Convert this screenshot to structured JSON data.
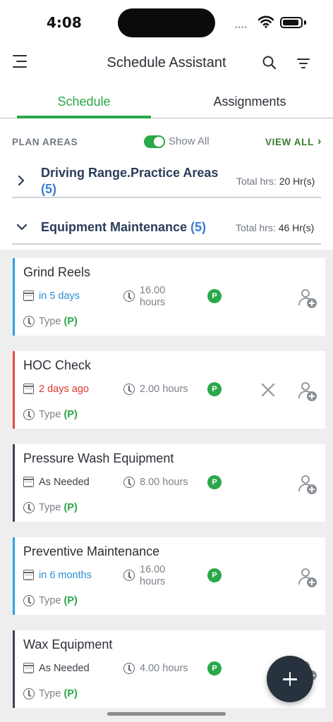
{
  "status_bar": {
    "time": "4:08",
    "battery_level": 0.9
  },
  "header": {
    "title": "Schedule Assistant"
  },
  "tabs": [
    {
      "label": "Schedule",
      "active": true
    },
    {
      "label": "Assignments",
      "active": false
    }
  ],
  "plan_areas": {
    "label": "PLAN AREAS",
    "show_all_label": "Show All",
    "show_all_on": true,
    "view_all_label": "VIEW ALL"
  },
  "sections": [
    {
      "title": "Driving Range.Practice Areas",
      "count": "(5)",
      "total_label": "Total hrs:",
      "total_value": "20 Hr(s)",
      "expanded": false
    },
    {
      "title": "Equipment Maintenance",
      "count": "(5)",
      "total_label": "Total hrs:",
      "total_value": "46 Hr(s)",
      "expanded": true
    }
  ],
  "tasks": [
    {
      "name": "Grind Reels",
      "due": "in 5 days",
      "hours_value": "16.00",
      "hours_unit": "hours",
      "badge": "P",
      "type_label": "Type",
      "type_value": "(P)",
      "status": "upcoming",
      "accent": "#2aa0e6",
      "due_color": "#2a8fd6"
    },
    {
      "name": "HOC Check",
      "due": "2 days ago",
      "hours_value": "2.00 hours",
      "hours_unit": "",
      "badge": "P",
      "type_label": "Type",
      "type_value": "(P)",
      "status": "overdue",
      "accent": "#e04a3f",
      "due_color": "#d9382c"
    },
    {
      "name": "Pressure Wash Equipment",
      "due": "As Needed",
      "hours_value": "8.00 hours",
      "hours_unit": "",
      "badge": "P",
      "type_label": "Type",
      "type_value": "(P)",
      "status": "as-needed",
      "accent": "#3a4452",
      "due_color": "#3a4046"
    },
    {
      "name": "Preventive Maintenance",
      "due": "in 6 months",
      "hours_value": "16.00",
      "hours_unit": "hours",
      "badge": "P",
      "type_label": "Type",
      "type_value": "(P)",
      "status": "upcoming",
      "accent": "#2aa0e6",
      "due_color": "#2a8fd6"
    },
    {
      "name": "Wax Equipment",
      "due": "As Needed",
      "hours_value": "4.00 hours",
      "hours_unit": "",
      "badge": "P",
      "type_label": "Type",
      "type_value": "(P)",
      "status": "as-needed",
      "accent": "#3a4452",
      "due_color": "#3a4046"
    }
  ],
  "icons": {
    "menu": "hamburger-menu-icon",
    "search": "search-icon",
    "filter": "filter-icon",
    "chevron_right": "chevron-right-icon",
    "chevron_down": "chevron-down-icon",
    "calendar": "calendar-icon",
    "clock": "clock-icon",
    "assign": "add-person-icon",
    "close": "close-icon",
    "add": "plus-icon"
  },
  "colors": {
    "accent_green": "#2aa84a",
    "count_blue": "#3a7fd0",
    "header_navy": "#2b3e5a",
    "fab": "#27323e"
  }
}
